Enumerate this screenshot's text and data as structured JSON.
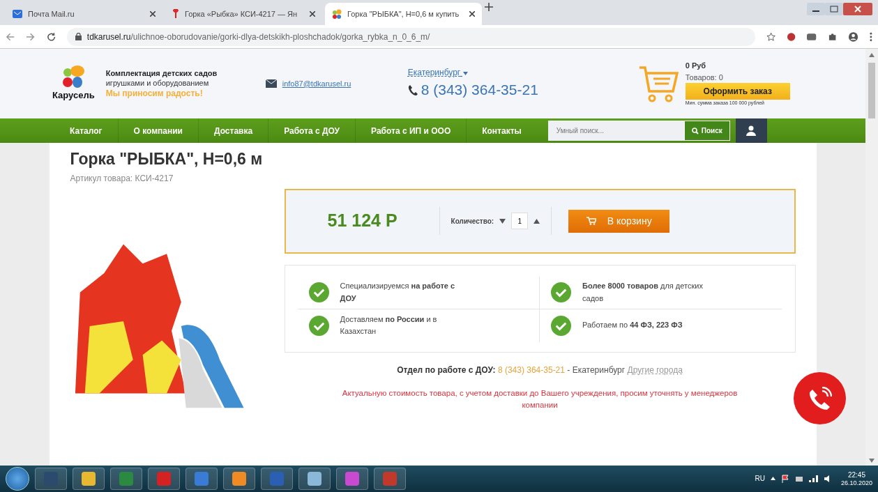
{
  "browser": {
    "tabs": [
      {
        "title": "Почта Mail.ru",
        "selected": false
      },
      {
        "title": "Горка «Рыбка» КСИ-4217 — Ян",
        "selected": false
      },
      {
        "title": "Горка \"РЫБКА\", Н=0,6 м купить",
        "selected": true
      }
    ],
    "url_domain": "tdkarusel.ru",
    "url_path": "/ulichnoe-oborudovanie/gorki-dlya-detskikh-ploshchadok/gorka_rybka_n_0_6_m/"
  },
  "header": {
    "logo": "Карусель",
    "tagline_1": "Комплектация детских садов",
    "tagline_2": "игрушками и оборудованием",
    "slogan": "Мы приносим радость!",
    "email": "info87@tdkarusel.ru",
    "city": "Екатеринбург",
    "phone": "8 (343) 364-35-21",
    "cart_total": "0 Руб",
    "cart_count": "Товаров: 0",
    "order_button": "Оформить заказ",
    "min_order": "Мин. сумма заказа 100 000 рублей"
  },
  "nav": {
    "items": [
      "Каталог",
      "О компании",
      "Доставка",
      "Работа с ДОУ",
      "Работа с ИП и ООО",
      "Контакты"
    ],
    "search": {
      "placeholder": "Умный поиск..."
    },
    "search_button": "Поиск"
  },
  "product": {
    "title": "Горка \"РЫБКА\", Н=0,6 м",
    "sku": "Артикул товара: КСИ-4217",
    "price": "51 124 Р",
    "quantity_label": "Количество:",
    "quantity": "1",
    "cart_button": "В корзину"
  },
  "features": [
    {
      "text": "Специализируемся **на работе с ДОУ**"
    },
    {
      "text": "**Более 8000 товаров** для детских садов"
    },
    {
      "text": "Доставляем **по России** и в Казахстан"
    },
    {
      "text": "Работаем по **44 ФЗ, 223 ФЗ**"
    }
  ],
  "department": {
    "label": "Отдел по работе с ДОУ:",
    "phone": "8 (343) 364-35-21",
    "city": "- Екатеринбург",
    "other_cities": "Другие города"
  },
  "note": "Актуальную стоимость товара, с учетом доставки до Вашего учреждения, просим уточнять у менеджеров компании",
  "taskbar": {
    "language": "RU",
    "time": "22:45",
    "date": "26.10.2020"
  }
}
